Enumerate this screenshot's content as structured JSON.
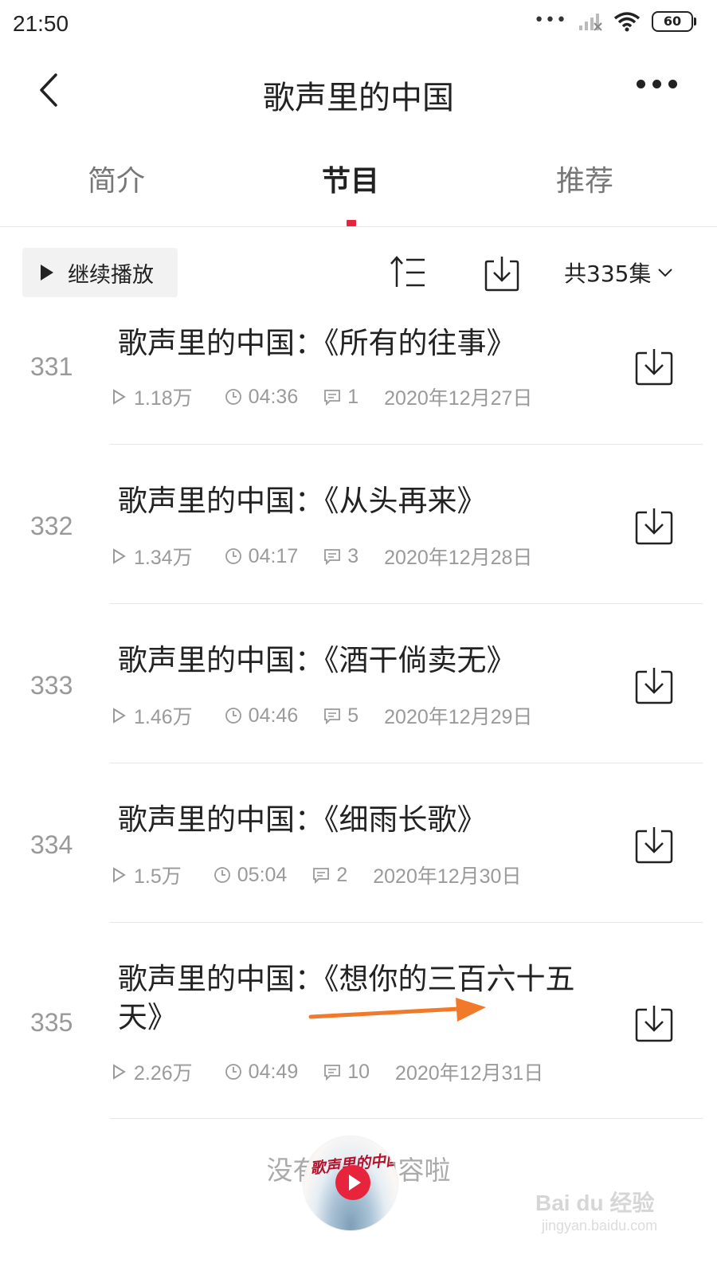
{
  "status_bar": {
    "time": "21:50",
    "signal_dots": "•••",
    "battery": "60"
  },
  "nav": {
    "title": "歌声里的中国"
  },
  "tabs": [
    {
      "label": "简介",
      "active": false
    },
    {
      "label": "节目",
      "active": true
    },
    {
      "label": "推荐",
      "active": false
    }
  ],
  "toolbar": {
    "continue_label": "继续播放",
    "episode_count": "共335集"
  },
  "episodes": [
    {
      "number": "331",
      "title": "歌声里的中国：《所有的往事》",
      "plays": "1.18万",
      "duration": "04:36",
      "comments": "1",
      "date": "2020年12月27日"
    },
    {
      "number": "332",
      "title": "歌声里的中国：《从头再来》",
      "plays": "1.34万",
      "duration": "04:17",
      "comments": "3",
      "date": "2020年12月28日"
    },
    {
      "number": "333",
      "title": "歌声里的中国：《酒干倘卖无》",
      "plays": "1.46万",
      "duration": "04:46",
      "comments": "5",
      "date": "2020年12月29日"
    },
    {
      "number": "334",
      "title": "歌声里的中国：《细雨长歌》",
      "plays": "1.5万",
      "duration": "05:04",
      "comments": "2",
      "date": "2020年12月30日"
    },
    {
      "number": "335",
      "title": "歌声里的中国：《想你的三百六十五天》",
      "plays": "2.26万",
      "duration": "04:49",
      "comments": "10",
      "date": "2020年12月31日"
    }
  ],
  "footer": {
    "end_text": "没有更多内容啦"
  },
  "mini_player": {
    "cover_text": "歌声里的中国"
  },
  "watermark": {
    "brand": "Bai du 经验",
    "url": "jingyan.baidu.com"
  },
  "colors": {
    "accent": "#e8243c",
    "annotation_arrow": "#f07a2a"
  }
}
